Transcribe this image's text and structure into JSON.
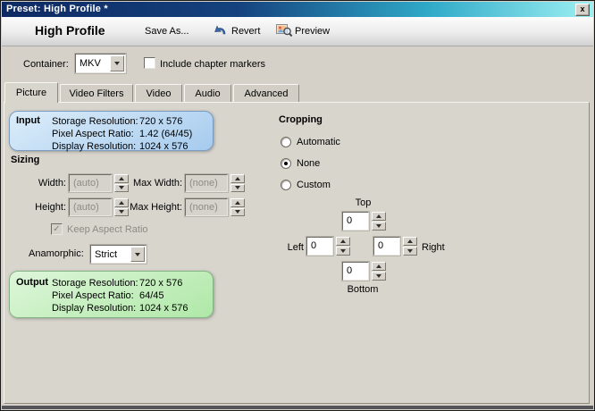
{
  "colors": {
    "titlebar_left": "#0e2a63",
    "titlebar_mid": "#2fa9c8",
    "titlebar_right": "#9df0f2",
    "input_box_border": "#7a9cc0",
    "input_box_top": "#dcedfa",
    "input_box_bottom": "#a6cbee",
    "output_box_border": "#85b584",
    "output_box_top": "#def6da",
    "output_box_bottom": "#afe8a7",
    "window_bg": "#d5d1c9",
    "panel_bg": "#d8d5cd"
  },
  "window": {
    "title": "Preset: High Profile *",
    "close": "x"
  },
  "toolbar": {
    "preset_name": "High Profile",
    "save_as": "Save As...",
    "revert": "Revert",
    "preview": "Preview"
  },
  "container_row": {
    "label": "Container:",
    "value": "MKV",
    "chapters_label": "Include chapter markers",
    "chapters_checked": false
  },
  "tabs": {
    "picture": "Picture",
    "video_filters": "Video Filters",
    "video": "Video",
    "audio": "Audio",
    "advanced": "Advanced",
    "active": "Picture"
  },
  "input_box": {
    "title": "Input",
    "rows": [
      {
        "label": "Storage Resolution:",
        "value": "720 x 576"
      },
      {
        "label": "Pixel Aspect Ratio:",
        "value": "1.42 (64/45)"
      },
      {
        "label": "Display Resolution:",
        "value": "1024 x 576"
      }
    ]
  },
  "sizing": {
    "title": "Sizing",
    "width_label": "Width:",
    "width_value": "(auto)",
    "max_width_label": "Max Width:",
    "max_width_value": "(none)",
    "height_label": "Height:",
    "height_value": "(auto)",
    "max_height_label": "Max Height:",
    "max_height_value": "(none)",
    "keep_aspect_label": "Keep Aspect Ratio",
    "keep_aspect_checked": true,
    "keep_aspect_check": "✓",
    "anamorphic_label": "Anamorphic:",
    "anamorphic_value": "Strict"
  },
  "output_box": {
    "title": "Output",
    "rows": [
      {
        "label": "Storage Resolution:",
        "value": "720 x 576"
      },
      {
        "label": "Pixel Aspect Ratio:",
        "value": "64/45"
      },
      {
        "label": "Display Resolution:",
        "value": "1024 x 576"
      }
    ]
  },
  "cropping": {
    "title": "Cropping",
    "automatic": "Automatic",
    "none": "None",
    "custom": "Custom",
    "selected": "None",
    "top_label": "Top",
    "left_label": "Left",
    "right_label": "Right",
    "bottom_label": "Bottom",
    "top": "0",
    "left": "0",
    "right": "0",
    "bottom": "0"
  }
}
